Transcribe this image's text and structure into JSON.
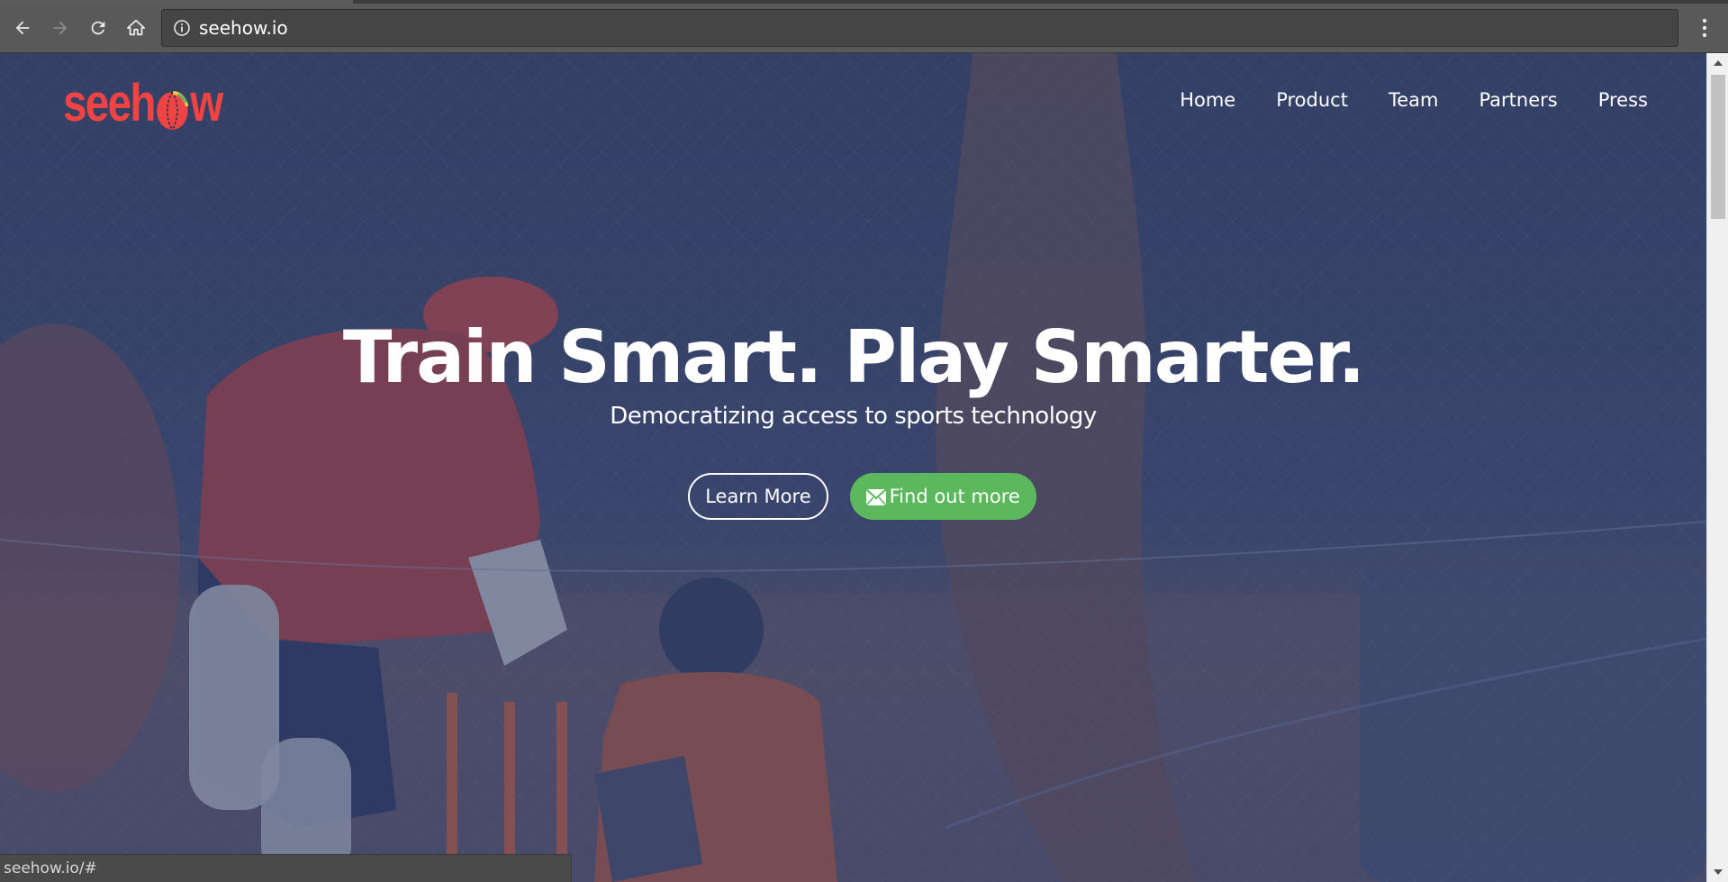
{
  "browser": {
    "url": "seehow.io",
    "status_url": "seehow.io/#",
    "icons": [
      "back-arrow-icon",
      "forward-arrow-icon",
      "reload-icon",
      "home-icon",
      "info-icon",
      "menu-dots-icon"
    ]
  },
  "site": {
    "brand_name": "seehow",
    "brand_color": "#f04343",
    "nav": {
      "items": [
        {
          "label": "Home"
        },
        {
          "label": "Product"
        },
        {
          "label": "Team"
        },
        {
          "label": "Partners"
        },
        {
          "label": "Press"
        }
      ]
    },
    "hero": {
      "headline": "Train Smart. Play Smarter.",
      "subheadline": "Democratizing access to sports technology",
      "learn_more_label": "Learn More",
      "find_out_label": "Find out more",
      "find_out_color": "#5cb85c"
    }
  }
}
